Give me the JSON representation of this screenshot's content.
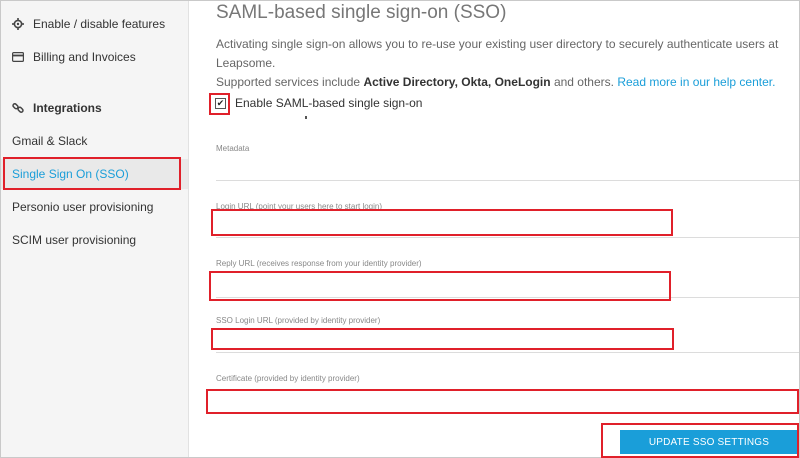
{
  "sidebar": {
    "items": [
      {
        "label": "Enable / disable features",
        "icon": "gear-icon"
      },
      {
        "label": "Billing and Invoices",
        "icon": "credit-card-icon"
      },
      {
        "label": "Integrations",
        "icon": "link-icon"
      },
      {
        "label": "Gmail & Slack"
      },
      {
        "label": "Single Sign On (SSO)"
      },
      {
        "label": "Personio user provisioning"
      },
      {
        "label": "SCIM user provisioning"
      }
    ]
  },
  "main": {
    "title": "SAML-based single sign-on (SSO)",
    "desc_line1": "Activating single sign-on allows you to re-use your existing user directory to securely authenticate users at Leapsome.",
    "desc_prefix": "Supported services include",
    "desc_bold": "Active Directory, Okta, OneLogin",
    "desc_and": "and others.",
    "desc_link": "Read more in our help center.",
    "enable_label": "Enable SAML-based single sign-on",
    "enable_checked": true,
    "fields": {
      "metadata": "Metadata",
      "login_url": "Login URL (point your users here to start login)",
      "reply_url": "Reply URL (receives response from your identity provider)",
      "sso_login_url": "SSO Login URL (provided by identity provider)",
      "certificate": "Certificate (provided by identity provider)"
    },
    "update_button": "UPDATE SSO SETTINGS"
  },
  "colors": {
    "accent": "#1a9ed9",
    "highlight": "#e0202a"
  }
}
